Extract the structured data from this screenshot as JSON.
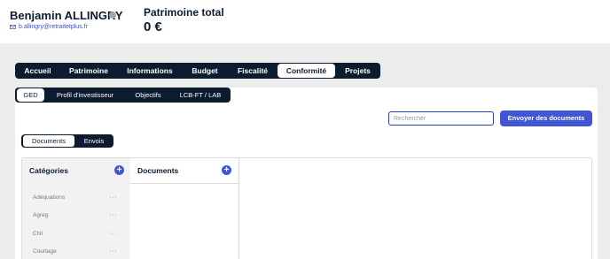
{
  "client": {
    "name": "Benjamin ALLINGRY",
    "email": "b.allingry@retraitetplus.fr"
  },
  "patrimoine": {
    "label": "Patrimoine total",
    "value": "0 €"
  },
  "main_tabs": [
    {
      "label": "Accueil"
    },
    {
      "label": "Patrimoine"
    },
    {
      "label": "Informations"
    },
    {
      "label": "Budget"
    },
    {
      "label": "Fiscalité"
    },
    {
      "label": "Conformité",
      "active": true
    },
    {
      "label": "Projets"
    }
  ],
  "sub_tabs": [
    {
      "label": "GED",
      "active": true
    },
    {
      "label": "Profil d'investisseur"
    },
    {
      "label": "Objectifs"
    },
    {
      "label": "LCB-FT / LAB"
    }
  ],
  "search": {
    "placeholder": "Rechercher",
    "value": ""
  },
  "send_button": {
    "label": "Envoyer des documents"
  },
  "view_toggle": [
    {
      "label": "Documents",
      "active": true
    },
    {
      "label": "Envois"
    }
  ],
  "categories": {
    "title": "Catégories",
    "add_symbol": "+",
    "items": [
      {
        "label": "Adéquations",
        "more": "···"
      },
      {
        "label": "Agreg",
        "more": "···"
      },
      {
        "label": "CNI",
        "more": "···"
      },
      {
        "label": "Courtage",
        "more": "···"
      }
    ]
  },
  "documents": {
    "title": "Documents",
    "add_symbol": "+"
  },
  "colors": {
    "navy": "#0c1b2e",
    "accent": "#4156d6",
    "link": "#3b4fd0"
  }
}
